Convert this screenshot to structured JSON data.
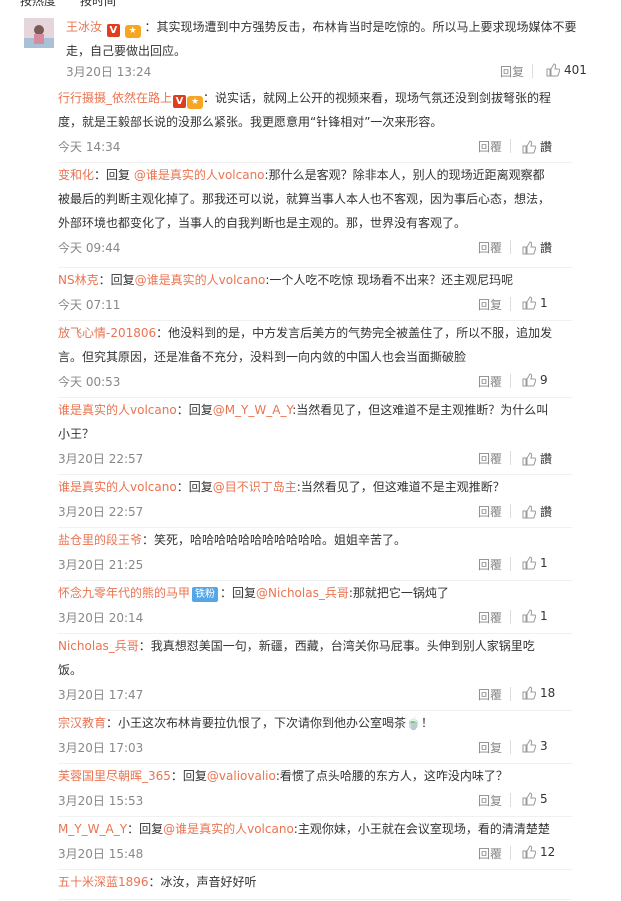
{
  "tabs": {
    "hot": "按热度",
    "time": "按时间"
  },
  "main_comment": {
    "author": "王冰汝",
    "text": "：其实现场遭到中方强势反击，布林肯当时是吃惊的。所以马上要求现场媒体不要走，自己要做出回应。",
    "time": "3月20日 13:24",
    "reply_label": "回复",
    "likes": "401"
  },
  "replies": [
    {
      "author": "行行摄摄_依然在路上",
      "badge": "v",
      "prefix": "",
      "mention": "",
      "text": "：说实话，就网上公开的视频来看，现场气氛还没到剑拔弩张的程度，就是王毅部长说的没那么紧张。我更愿意用“针锋相对”一次来形容。",
      "time": "今天 14:34",
      "reply_label": "回覆",
      "likes": "讚"
    },
    {
      "author": "变和化",
      "badge": "",
      "prefix": "：回复 ",
      "mention": "@谁是真实的人volcano",
      "text": ":那什么是客观？除非本人，别人的现场近距离观察都被最后的判断主观化掉了。那我还可以说，就算当事人本人也不客观，因为事后心态，想法，外部环境也都变化了，当事人的自我判断也是主观的。那，世界没有客观了。",
      "time": "今天 09:44",
      "reply_label": "回覆",
      "likes": "讚"
    },
    {
      "author": "NS林克",
      "badge": "",
      "prefix": "：回复",
      "mention": "@谁是真实的人volcano",
      "text": ":一个人吃不吃惊 现场看不出来？还主观尼玛呢",
      "time": "今天 07:11",
      "reply_label": "回复",
      "likes": "1"
    },
    {
      "author": "放飞心情-201806",
      "badge": "",
      "prefix": "",
      "mention": "",
      "text": "：他没料到的是，中方发言后美方的气势完全被盖住了，所以不服，追加发言。但究其原因，还是准备不充分，没料到一向内敛的中国人也会当面撕破脸",
      "time": "今天 00:53",
      "reply_label": "回覆",
      "likes": "9"
    },
    {
      "author": "谁是真实的人volcano",
      "badge": "",
      "prefix": "：回复",
      "mention": "@M_Y_W_A_Y",
      "text": ":当然看见了，但这难道不是主观推断？为什么叫小王？",
      "time": "3月20日 22:57",
      "reply_label": "回覆",
      "likes": "讚"
    },
    {
      "author": "谁是真实的人volcano",
      "badge": "",
      "prefix": "：回复",
      "mention": "@目不识丁岛主",
      "text": ":当然看见了，但这难道不是主观推断？",
      "time": "3月20日 22:57",
      "reply_label": "回覆",
      "likes": "讚"
    },
    {
      "author": "盐仓里的段王爷",
      "badge": "",
      "prefix": "",
      "mention": "",
      "text": "：笑死，哈哈哈哈哈哈哈哈哈哈哈。姐姐辛苦了。",
      "time": "3月20日 21:25",
      "reply_label": "回覆",
      "likes": "1"
    },
    {
      "author": "怀念九零年代的熊的马甲",
      "badge": "fan",
      "prefix": "：回复",
      "mention": "@Nicholas_兵哥",
      "text": ":那就把它一锅炖了",
      "time": "3月20日 20:14",
      "reply_label": "回覆",
      "likes": "1"
    },
    {
      "author": "Nicholas_兵哥",
      "badge": "",
      "prefix": "",
      "mention": "",
      "text": "：我真想怼美国一句，新疆，西藏，台湾关你马屁事。头伸到别人家锅里吃饭。",
      "time": "3月20日 17:47",
      "reply_label": "回覆",
      "likes": "18"
    },
    {
      "author": "宗汉教育",
      "badge": "",
      "prefix": "",
      "mention": "",
      "text": "：小王这次布林肯要拉仇恨了，下次请你到他办公室喝茶🍵！",
      "time": "3月20日 17:03",
      "reply_label": "回复",
      "likes": "3"
    },
    {
      "author": "芙蓉国里尽朝晖_365",
      "badge": "",
      "prefix": "：回复",
      "mention": "@valiovalio",
      "text": ":看惯了点头哈腰的东方人，这咋没内味了？",
      "time": "3月20日 15:53",
      "reply_label": "回复",
      "likes": "5"
    },
    {
      "author": "M_Y_W_A_Y",
      "badge": "",
      "prefix": "：回复",
      "mention": "@谁是真实的人volcano",
      "text": ":主观你妹，小王就在会议室现场，看的清清楚楚",
      "time": "3月20日 15:48",
      "reply_label": "回覆",
      "likes": "12"
    },
    {
      "author": "五十米深蓝1896",
      "badge": "",
      "prefix": "",
      "mention": "",
      "text": "：冰汝，声音好好听",
      "time": "",
      "reply_label": "",
      "likes": ""
    }
  ],
  "colors": {
    "name": "#eb7350",
    "text": "#333333",
    "meta": "#888888",
    "vip": "#e03c1e",
    "fan": "#54a6e7"
  },
  "icons": {
    "like": "thumb-up-icon",
    "vip": "vip-badge-icon"
  }
}
